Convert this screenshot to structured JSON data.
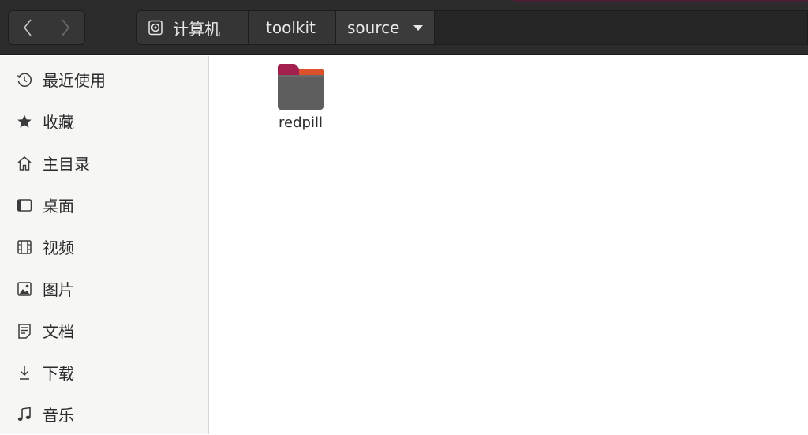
{
  "window": {
    "nav": {
      "back_icon": "chevron-left-icon",
      "forward_icon": "chevron-right-icon"
    },
    "pathbar": {
      "crumbs": [
        {
          "label": "计算机",
          "icon": "drive-icon"
        },
        {
          "label": "toolkit"
        },
        {
          "label": "source",
          "has_menu": true
        }
      ]
    }
  },
  "sidebar": {
    "items": [
      {
        "label": "最近使用",
        "icon": "clock-icon"
      },
      {
        "label": "收藏",
        "icon": "star-icon"
      },
      {
        "label": "主目录",
        "icon": "home-icon"
      },
      {
        "label": "桌面",
        "icon": "desktop-icon"
      },
      {
        "label": "视频",
        "icon": "film-icon"
      },
      {
        "label": "图片",
        "icon": "image-icon"
      },
      {
        "label": "文档",
        "icon": "document-icon"
      },
      {
        "label": "下载",
        "icon": "download-icon"
      },
      {
        "label": "音乐",
        "icon": "music-icon"
      }
    ]
  },
  "main": {
    "files": [
      {
        "name": "redpill",
        "type": "folder",
        "icon": "folder-icon"
      }
    ]
  },
  "colors": {
    "headerbar": "#2c2c2c",
    "folder_tab": "#a3204e",
    "folder_accent": "#e65a27",
    "folder_body": "#5e5e5e"
  }
}
